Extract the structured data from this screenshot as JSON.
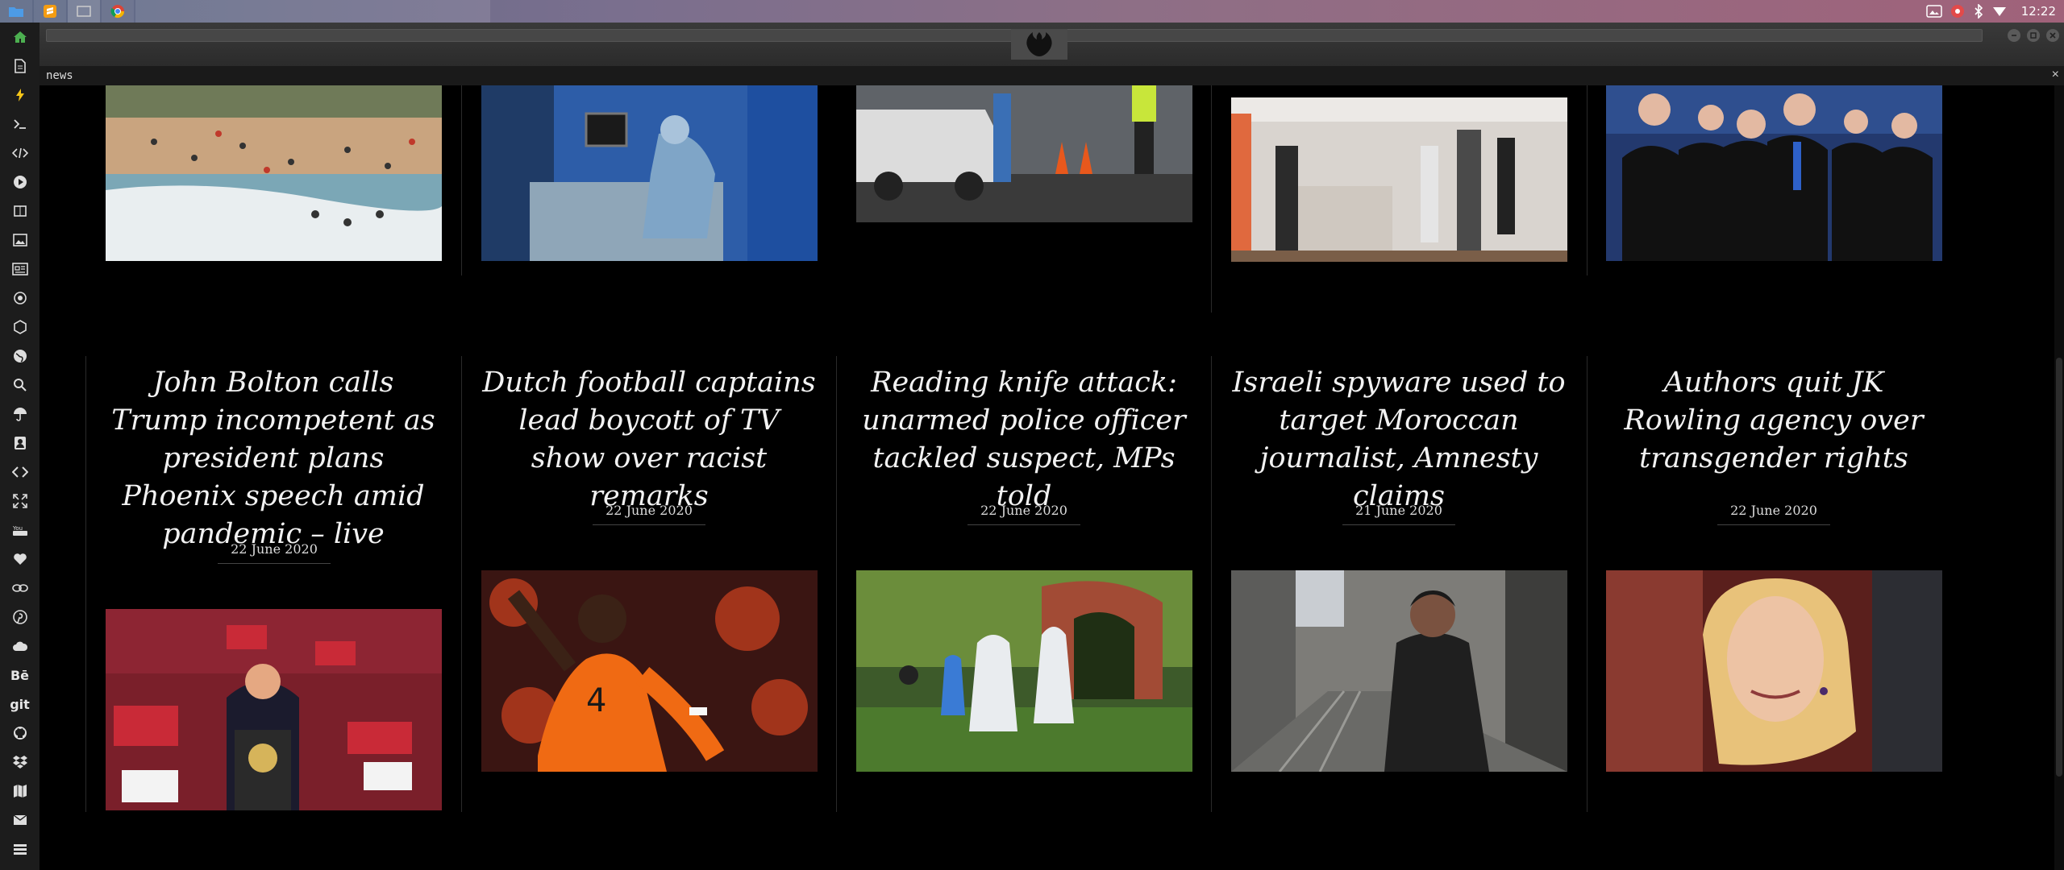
{
  "os": {
    "clock": "12:22",
    "taskbar_apps": [
      "files-icon",
      "sublime-icon",
      "blank-window",
      "chrome-icon"
    ],
    "tray_icons": [
      "photo-icon",
      "alert-icon",
      "bluetooth-icon",
      "wifi-icon"
    ]
  },
  "dock": {
    "items": [
      "home-icon",
      "document-icon",
      "bolt-icon",
      "terminal-icon",
      "code-icon",
      "play-icon",
      "book-icon",
      "image-icon",
      "news-icon",
      "settings-icon",
      "hexagon-icon",
      "globe-icon",
      "search-icon",
      "umbrella-icon",
      "contact-icon",
      "code-tag-icon",
      "expand-icon",
      "youtube-icon",
      "heart-icon",
      "link-icon",
      "pinterest-icon",
      "cloud-icon",
      "behance-icon",
      "git-icon",
      "github-icon",
      "dropbox-icon",
      "map-icon",
      "mail-icon",
      "list-icon"
    ],
    "labels": {
      "behance": "Bē",
      "git": "git"
    }
  },
  "browser": {
    "tab_title": "news",
    "close_label": "×"
  },
  "articles": [
    {
      "headline": "John Bolton calls Trump incompetent as president plans Phoenix speech amid pandemic – live",
      "date": "22 June 2020"
    },
    {
      "headline": "Dutch football captains lead boycott of TV show over racist remarks",
      "date": "22 June 2020"
    },
    {
      "headline": "Reading knife attack: unarmed police officer tackled suspect, MPs told",
      "date": "22 June 2020"
    },
    {
      "headline": "Israeli spyware used to target Moroccan journalist, Amnesty claims",
      "date": "21 June 2020"
    },
    {
      "headline": "Authors quit JK Rowling agency over transgender rights",
      "date": "22 June 2020"
    }
  ],
  "colors": {
    "background": "#000000",
    "headline": "#f2f2f2",
    "divider": "#2a2a2a"
  }
}
